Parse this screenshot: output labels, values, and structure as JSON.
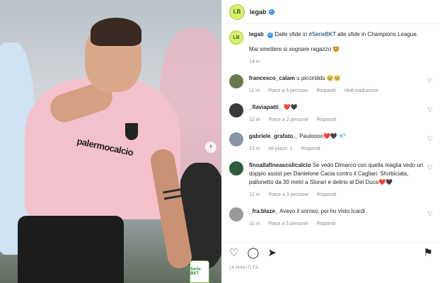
{
  "post": {
    "username": "legab",
    "avatar_text": "LB",
    "caption_parts": {
      "before": "Dalle sfide in ",
      "hashtag": "#SerieBKT",
      "after": " alle sfide in Champions League.",
      "line2": "Mai smettere si sognare ragazzo 🤩"
    },
    "caption_time": "14 m",
    "timestamp": "14 MINUTI FA",
    "image": {
      "sponsor_text": "palermocalcio",
      "league_badge": "Serie BKT"
    }
  },
  "comments": [
    {
      "username": "francesco_calam",
      "text": "u picciriddu 🥹🥹",
      "time": "11 m",
      "likes": "Piace a 5 persone",
      "reply": "Rispondi",
      "extra": "Vedi traduzione",
      "avatar_color": "#6b7a4e"
    },
    {
      "username": "_flaviapatti_",
      "text": "❤️🖤",
      "time": "12 m",
      "likes": "Piace a 2 persone",
      "reply": "Rispondi",
      "extra": "",
      "avatar_color": "#3a3a3a"
    },
    {
      "username": "gabriele_grafato._",
      "text": "Pauloooo❤️🖤 💎",
      "time": "13 m",
      "likes": "Mi piace: 1",
      "reply": "Rispondi",
      "extra": "",
      "avatar_color": "#8a95a8"
    },
    {
      "username": "finoallafineascolicalcio",
      "text": "Se vedo Dimarco con quella maglia vedo un doppio assist per Danielone Cacia contro il Cagliari. Sforbiciata, pallonetto da 30 metri a Storari e delirio al Del Duca❤️🖤",
      "time": "12 m",
      "likes": "Piace a 3 persone",
      "reply": "Rispondi",
      "extra": "",
      "avatar_color": "#2d5d3a"
    },
    {
      "username": "_fra.blaze_",
      "text": "Avevo il sorriso, poi ho visto Icardi",
      "time": "11 m",
      "likes": "Piace a 5 persone",
      "reply": "Rispondi",
      "extra": "",
      "avatar_color": "#9a9a9a"
    }
  ],
  "icons": {
    "like": "heart-icon",
    "comment": "comment-icon",
    "share": "share-icon",
    "save": "bookmark-icon",
    "verified": "verified-icon",
    "next": "chevron-right-icon"
  },
  "colors": {
    "hashtag": "#00376b",
    "meta": "#8e8e8e",
    "verified": "#3897f0",
    "shirt": "#f3c1cc"
  }
}
